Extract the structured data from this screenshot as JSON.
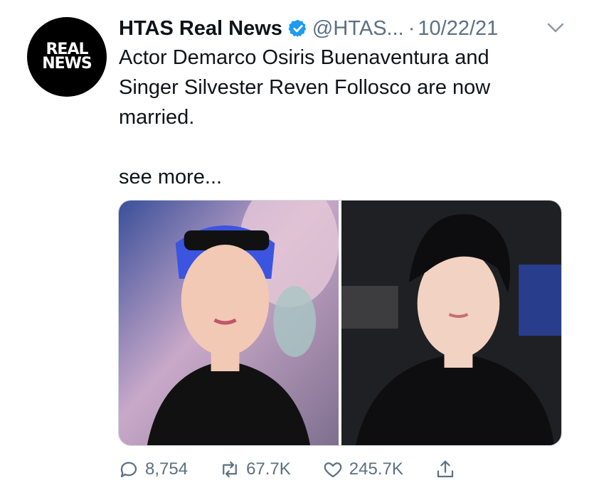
{
  "account": {
    "avatar_line1": "REAL",
    "avatar_line2": "NEWS",
    "name": "HTAS Real News",
    "handle": "@HTAS...",
    "separator": "·",
    "date": "10/22/21"
  },
  "tweet": {
    "text_line1": "Actor Demarco Osiris Buenaventura and",
    "text_line2": "Singer Silvester Reven Follosco are now",
    "text_line3": "married.",
    "see_more": "see more..."
  },
  "actions": {
    "replies": "8,754",
    "retweets": "67.7K",
    "likes": "245.7K"
  },
  "colors": {
    "verified": "#1d9bf0",
    "secondary_text": "#5b7083"
  },
  "icons": [
    "verified-badge-icon",
    "chevron-down-icon",
    "reply-icon",
    "retweet-icon",
    "like-icon",
    "share-icon"
  ]
}
